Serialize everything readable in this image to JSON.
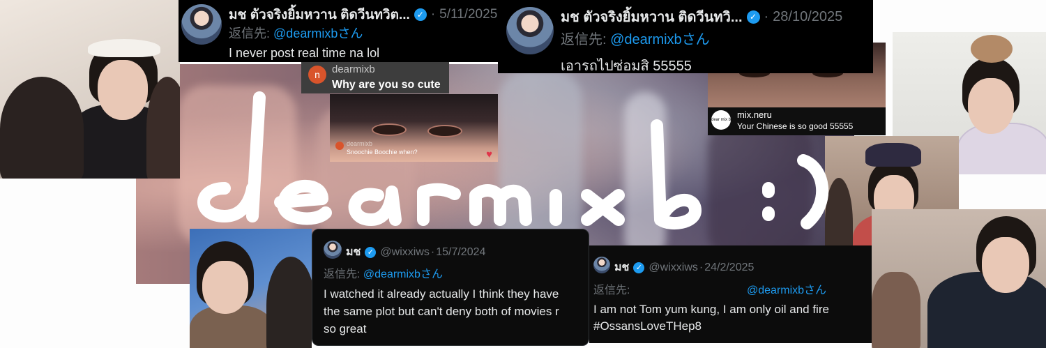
{
  "handwriting": {
    "text": "dear mixb :)"
  },
  "tweets": [
    {
      "name": "มช ตัวจริงยิ้มหวาน ติดวีนทวิต...",
      "handle": "",
      "date": "5/11/2025",
      "reply_prefix": "返信先:",
      "mention": "@dearmixb",
      "reply_suffix": "さん",
      "text": "I never post real time na lol"
    },
    {
      "name": "มช ตัวจริงยิ้มหวาน ติดวีนทวิ...",
      "handle": "",
      "date": "28/10/2025",
      "reply_prefix": "返信先:",
      "mention": "@dearmixb",
      "reply_suffix": "さん",
      "text": "เอารถไปซ่อมสิ 55555"
    },
    {
      "name": "มช",
      "handle": "@wixxiws",
      "date": "15/7/2024",
      "reply_prefix": "返信先:",
      "mention": "@dearmixb",
      "reply_suffix": "さん",
      "text": "I watched it already actually I think they have the same plot but can't deny both of movies r so great"
    },
    {
      "name": "มช",
      "handle": "@wixxiws",
      "date": "24/2/2025",
      "reply_prefix": "返信先:",
      "mention": "@dearmixb",
      "reply_suffix": "さん",
      "text": "I am not Tom yum kung,  I am only oil and fire #OssansLoveTHep8"
    }
  ],
  "comments": {
    "cute": {
      "avatar_letter": "n",
      "user": "dearmixb",
      "text": "Why are you so cute"
    },
    "snoochie": {
      "user": "dearmixb",
      "text": "Snoochie Boochie when?"
    },
    "neru": {
      "logo": "dear mix b",
      "user": "mix.neru",
      "text": "Your Chinese is so good 55555"
    }
  },
  "icons": {
    "verified": "verified-badge-icon",
    "heart": "heart-icon"
  },
  "colors": {
    "twitter_blue": "#1d9bf0",
    "tweet_bg": "#000000",
    "muted": "#71767b",
    "comment_avatar": "#d9542b"
  }
}
